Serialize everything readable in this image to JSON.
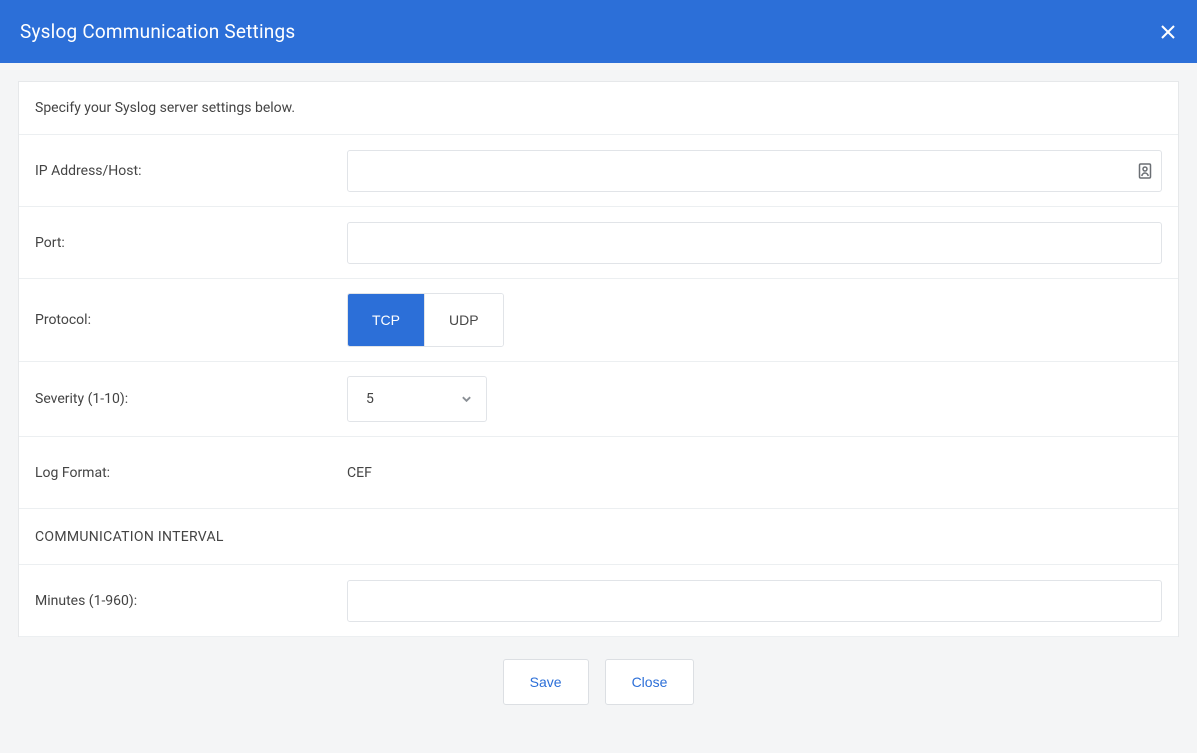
{
  "dialog": {
    "title": "Syslog Communication Settings",
    "intro": "Specify your Syslog server settings below."
  },
  "form": {
    "ip_label": "IP Address/Host:",
    "ip_value": "",
    "port_label": "Port:",
    "port_value": "",
    "protocol_label": "Protocol:",
    "protocol_options": {
      "tcp": "TCP",
      "udp": "UDP"
    },
    "protocol_selected": "TCP",
    "severity_label": "Severity (1-10):",
    "severity_value": "5",
    "logformat_label": "Log Format:",
    "logformat_value": "CEF",
    "section_interval": "COMMUNICATION INTERVAL",
    "minutes_label": "Minutes (1-960):",
    "minutes_value": ""
  },
  "footer": {
    "save": "Save",
    "close": "Close"
  }
}
